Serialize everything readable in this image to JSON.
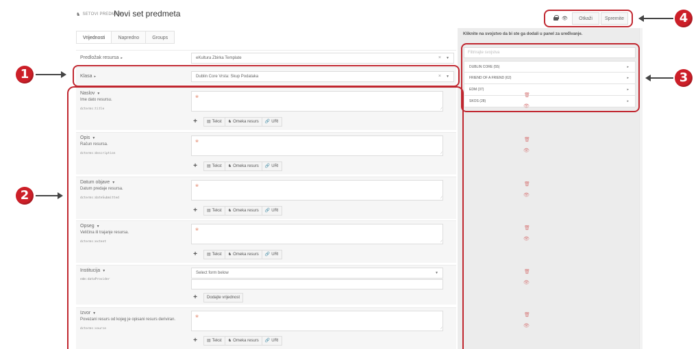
{
  "header": {
    "breadcrumb": "SETOVI PREDMETA",
    "title": "Novi set predmeta"
  },
  "tabs": [
    "Vrijednosti",
    "Napredno",
    "Groups"
  ],
  "top_buttons": {
    "cancel": "Otkaži",
    "save": "Spremite"
  },
  "right_panel": {
    "hint": "Kliknite na svojstvo da bi ste ga dodali u panel za uređivanje.",
    "filter_placeholder": "Filtrirajte svojstva",
    "vocabularies": [
      "DUBLIN CORE (55)",
      "FRIEND OF A FRIEND (62)",
      "EDM (37)",
      "SKOS (28)"
    ]
  },
  "resource_template": {
    "label": "Predložak resursa",
    "value": "eKultura Zbirka Template"
  },
  "class": {
    "label": "Klasa",
    "value": "Dublin Core Vrsta: Skup Podataka"
  },
  "properties": [
    {
      "label": "Naslov",
      "desc": "Ime dato resursu.",
      "term": "dcterms:title"
    },
    {
      "label": "Opis",
      "desc": "Račun resursa.",
      "term": "dcterms:description"
    },
    {
      "label": "Datum objave",
      "desc": "Datum predaje resursa.",
      "term": "dcterms:dateSubmitted"
    },
    {
      "label": "Opseg",
      "desc": "Veličina ili trajanje resursa.",
      "term": "dcterms:extent"
    },
    {
      "label": "Institucija",
      "desc": "",
      "term": "edm:dataProvider"
    },
    {
      "label": "Izvor",
      "desc": "Povezani resurs od kojeg je opisani resurs deriviran.",
      "term": "dcterms:source"
    }
  ],
  "value_buttons": {
    "text": "Tekst",
    "omeka": "Omeka resurs",
    "uri": "URI"
  },
  "institution": {
    "select_placeholder": "Select form below",
    "add_value": "Dodajte vrijednost"
  },
  "annotations": [
    "1",
    "2",
    "3",
    "4"
  ],
  "colors": {
    "annotation": "#cc1f28",
    "panel_bg": "#ececec"
  }
}
